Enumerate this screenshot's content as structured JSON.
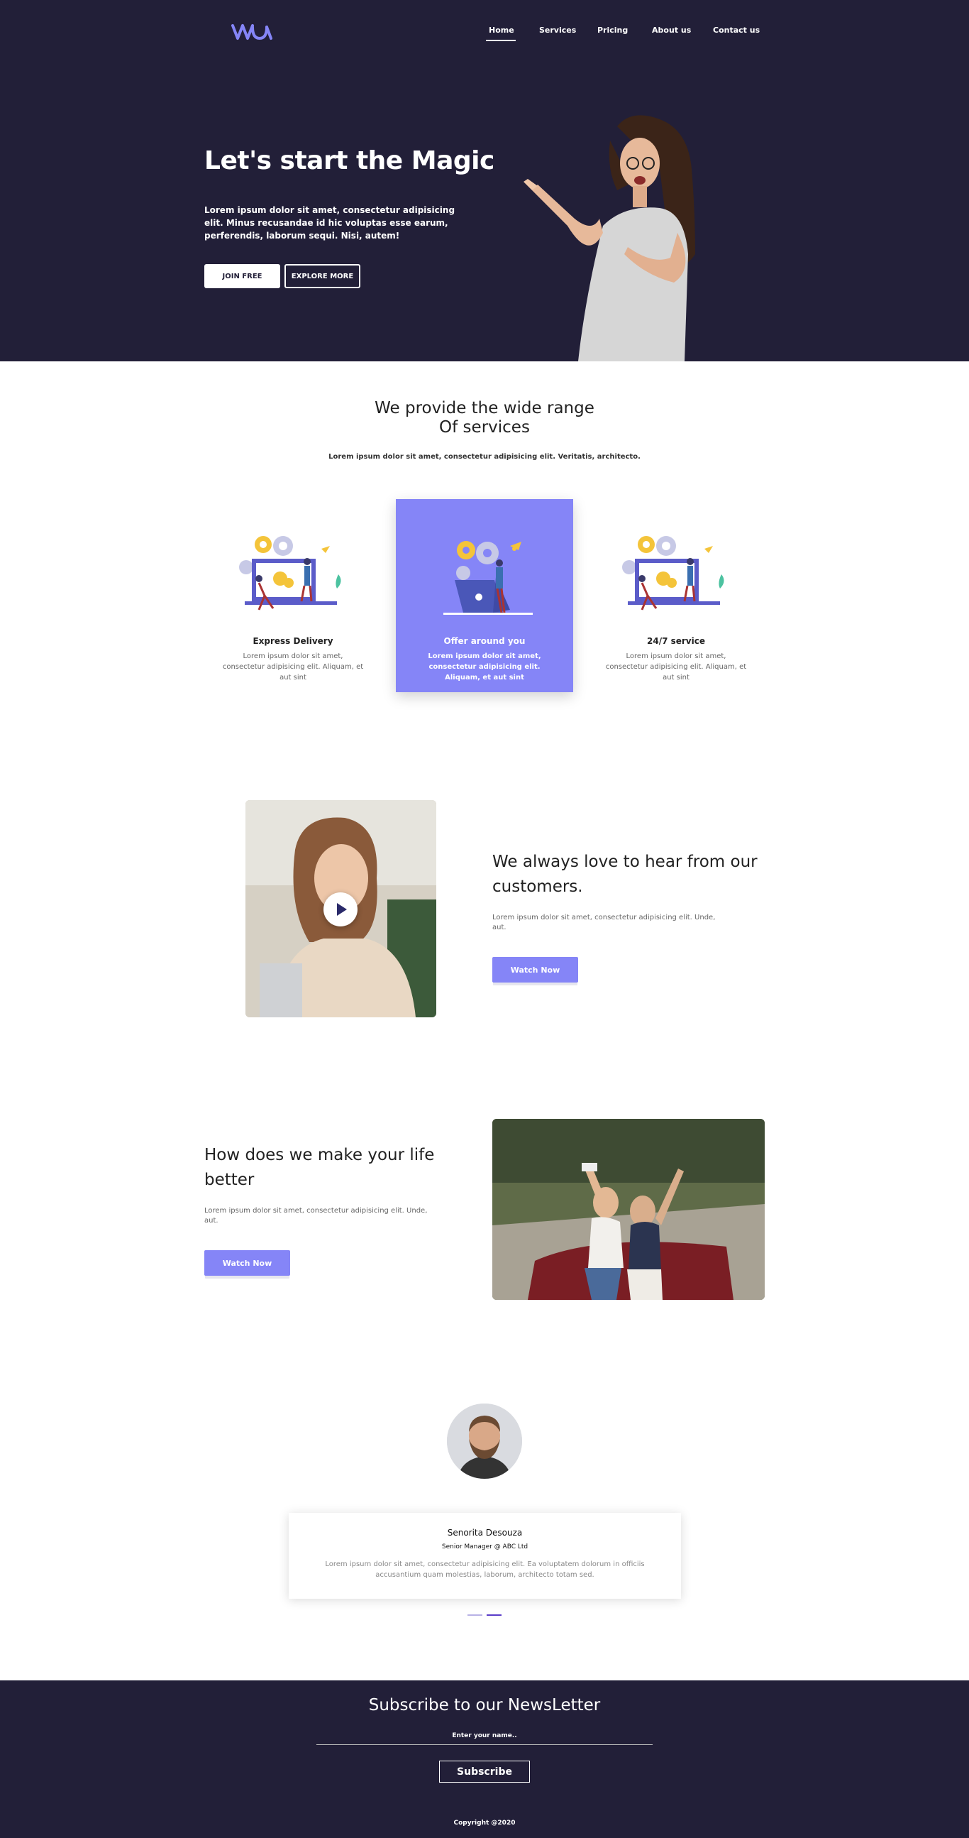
{
  "brand": {
    "logo_text": "vudu",
    "accent": "#8585f7",
    "dark_bg": "#221f38"
  },
  "nav": {
    "items": [
      "Home",
      "Services",
      "Pricing",
      "About us",
      "Contact us"
    ],
    "active": "Home"
  },
  "hero": {
    "title": "Let's start the Magic",
    "text": "Lorem ipsum dolor sit amet, consectetur adipisicing elit. Minus recusandae id hic voluptas esse earum, perferendis, laborum sequi. Nisi, autem!",
    "join_label": "JOIN FREE",
    "explore_label": "EXPLORE MORE"
  },
  "services": {
    "title_line1": "We provide the wide range",
    "title_line2": "Of services",
    "subtitle": "Lorem ipsum dolor sit amet, consectetur adipisicing elit. Veritatis, architecto.",
    "cards": [
      {
        "title": "Express Delivery",
        "text": "Lorem ipsum dolor sit amet, consectetur adipisicing elit. Aliquam, et aut sint",
        "icon": "laptop-gears-illustration"
      },
      {
        "title": "Offer around you",
        "text": "Lorem ipsum dolor sit amet, consectetur adipisicing elit. Aliquam, et aut sint",
        "icon": "laptop-gears-illustration"
      },
      {
        "title": "24/7 service",
        "text": "Lorem ipsum dolor sit amet, consectetur adipisicing elit. Aliquam, et aut sint",
        "icon": "laptop-gears-illustration"
      }
    ]
  },
  "feedback": {
    "title": "We always love to hear from our customers.",
    "text": "Lorem ipsum dolor sit amet, consectetur adipisicing elit. Unde, aut.",
    "button": "Watch Now"
  },
  "better": {
    "title": "How does we make your life better",
    "text": "Lorem ipsum dolor sit amet, consectetur adipisicing elit. Unde, aut.",
    "button": "Watch Now"
  },
  "testimonial": {
    "name": "Senorita Desouza",
    "role": "Senior Manager @ ABC Ltd",
    "text": "Lorem ipsum dolor sit amet, consectetur adipisicing elit. Ea voluptatem dolorum in officiis accusantium quam molestias, laborum, architecto totam sed."
  },
  "footer": {
    "title": "Subscribe to our NewsLetter",
    "input_placeholder": "Enter your name..",
    "subscribe": "Subscribe",
    "copyright": "Copyright @2020"
  }
}
